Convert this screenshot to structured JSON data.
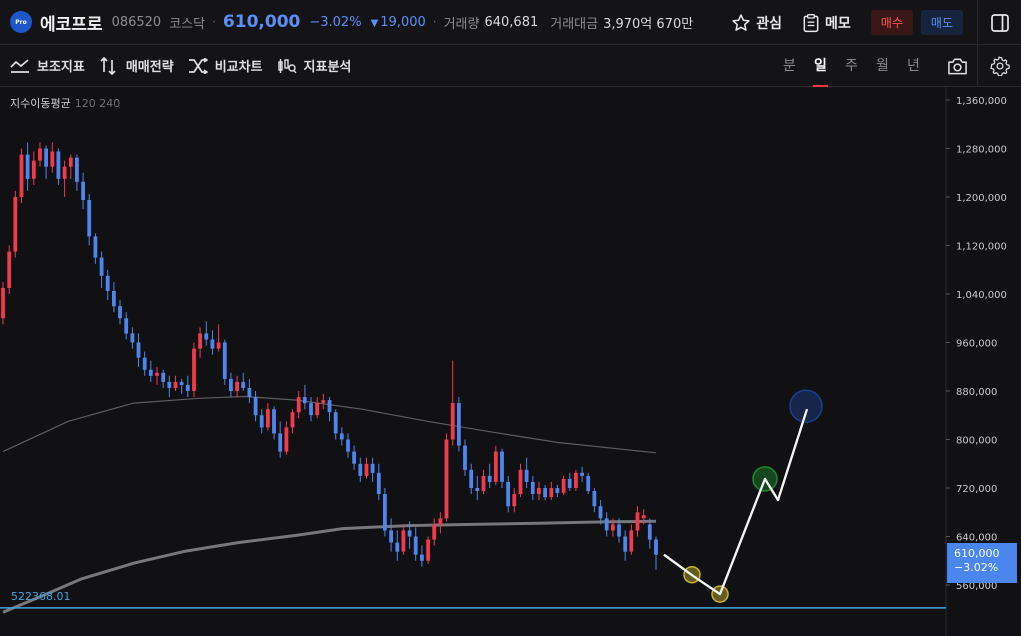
{
  "header": {
    "logo_text": "Pro",
    "stock_name": "에코프로",
    "stock_code": "086520",
    "market": "코스닥",
    "price": "610,000",
    "change_pct": "−3.02%",
    "change_abs": "19,000",
    "volume_label": "거래량",
    "volume_value": "640,681",
    "amount_label": "거래대금",
    "amount_value": "3,970억 670만",
    "watch_label": "관심",
    "memo_label": "메모",
    "buy_label": "매수",
    "sell_label": "매도",
    "colors": {
      "down": "#5b8ff6",
      "up": "#ff5050"
    }
  },
  "toolbar": {
    "tools": [
      "보조지표",
      "매매전략",
      "비교차트",
      "지표분석"
    ],
    "periods": [
      "분",
      "일",
      "주",
      "월",
      "년"
    ],
    "active_period": "일"
  },
  "chart_data": {
    "type": "candlestick",
    "indicator": {
      "name": "지수이동평균",
      "periods": "120 240"
    },
    "y_ticks": [
      "1,360,000",
      "1,280,000",
      "1,200,000",
      "1,120,000",
      "1,040,000",
      "960,000",
      "880,000",
      "800,000",
      "720,000",
      "640,000",
      "560,000"
    ],
    "y_tick_values": [
      1360000,
      1280000,
      1200000,
      1120000,
      1040000,
      960000,
      880000,
      800000,
      720000,
      640000,
      560000
    ],
    "ylim": [
      505000,
      1400000
    ],
    "current_price": {
      "value": 610000,
      "label": "610,000",
      "change": "−3.02%"
    },
    "support_line": {
      "value": 522368.01,
      "label": "522368.01",
      "color": "#3fa5dc"
    },
    "candles": [
      [
        1000000,
        1060000,
        990000,
        1050000
      ],
      [
        1050000,
        1120000,
        1040000,
        1110000
      ],
      [
        1110000,
        1210000,
        1100000,
        1200000
      ],
      [
        1200000,
        1280000,
        1190000,
        1270000
      ],
      [
        1270000,
        1290000,
        1210000,
        1230000
      ],
      [
        1230000,
        1275000,
        1220000,
        1260000
      ],
      [
        1260000,
        1290000,
        1250000,
        1280000
      ],
      [
        1280000,
        1285000,
        1230000,
        1250000
      ],
      [
        1250000,
        1290000,
        1240000,
        1275000
      ],
      [
        1275000,
        1280000,
        1220000,
        1230000
      ],
      [
        1230000,
        1260000,
        1200000,
        1250000
      ],
      [
        1250000,
        1270000,
        1230000,
        1265000
      ],
      [
        1265000,
        1270000,
        1210000,
        1225000
      ],
      [
        1225000,
        1240000,
        1180000,
        1195000
      ],
      [
        1195000,
        1205000,
        1120000,
        1135000
      ],
      [
        1135000,
        1140000,
        1090000,
        1100000
      ],
      [
        1100000,
        1110000,
        1050000,
        1070000
      ],
      [
        1070000,
        1080000,
        1030000,
        1045000
      ],
      [
        1045000,
        1060000,
        1010000,
        1020000
      ],
      [
        1020000,
        1030000,
        990000,
        1000000
      ],
      [
        1000000,
        1010000,
        965000,
        975000
      ],
      [
        975000,
        985000,
        950000,
        960000
      ],
      [
        960000,
        975000,
        920000,
        935000
      ],
      [
        935000,
        945000,
        905000,
        915000
      ],
      [
        915000,
        930000,
        895000,
        905000
      ],
      [
        905000,
        920000,
        890000,
        910000
      ],
      [
        910000,
        915000,
        885000,
        895000
      ],
      [
        895000,
        905000,
        870000,
        885000
      ],
      [
        885000,
        905000,
        880000,
        895000
      ],
      [
        895000,
        900000,
        875000,
        890000
      ],
      [
        890000,
        905000,
        870000,
        880000
      ],
      [
        880000,
        960000,
        870000,
        950000
      ],
      [
        950000,
        985000,
        935000,
        975000
      ],
      [
        975000,
        995000,
        955000,
        965000
      ],
      [
        965000,
        980000,
        940000,
        950000
      ],
      [
        950000,
        990000,
        945000,
        960000
      ],
      [
        960000,
        965000,
        890000,
        900000
      ],
      [
        900000,
        910000,
        870000,
        880000
      ],
      [
        880000,
        905000,
        870000,
        895000
      ],
      [
        895000,
        910000,
        880000,
        885000
      ],
      [
        885000,
        900000,
        860000,
        870000
      ],
      [
        870000,
        880000,
        830000,
        840000
      ],
      [
        840000,
        850000,
        810000,
        820000
      ],
      [
        820000,
        860000,
        815000,
        850000
      ],
      [
        850000,
        855000,
        800000,
        810000
      ],
      [
        810000,
        830000,
        770000,
        780000
      ],
      [
        780000,
        830000,
        775000,
        820000
      ],
      [
        820000,
        850000,
        810000,
        845000
      ],
      [
        845000,
        880000,
        835000,
        870000
      ],
      [
        870000,
        890000,
        850000,
        860000
      ],
      [
        860000,
        870000,
        830000,
        840000
      ],
      [
        840000,
        870000,
        835000,
        860000
      ],
      [
        860000,
        875000,
        850000,
        865000
      ],
      [
        865000,
        870000,
        830000,
        845000
      ],
      [
        845000,
        850000,
        800000,
        810000
      ],
      [
        810000,
        820000,
        790000,
        800000
      ],
      [
        800000,
        810000,
        770000,
        780000
      ],
      [
        780000,
        790000,
        750000,
        760000
      ],
      [
        760000,
        770000,
        730000,
        740000
      ],
      [
        740000,
        770000,
        735000,
        760000
      ],
      [
        760000,
        770000,
        730000,
        745000
      ],
      [
        745000,
        760000,
        700000,
        710000
      ],
      [
        710000,
        720000,
        640000,
        650000
      ],
      [
        650000,
        670000,
        615000,
        630000
      ],
      [
        630000,
        650000,
        600000,
        615000
      ],
      [
        615000,
        660000,
        610000,
        650000
      ],
      [
        650000,
        665000,
        620000,
        640000
      ],
      [
        640000,
        655000,
        600000,
        610000
      ],
      [
        610000,
        625000,
        590000,
        600000
      ],
      [
        600000,
        640000,
        595000,
        635000
      ],
      [
        635000,
        670000,
        625000,
        660000
      ],
      [
        660000,
        680000,
        645000,
        670000
      ],
      [
        670000,
        810000,
        665000,
        800000
      ],
      [
        800000,
        930000,
        790000,
        860000
      ],
      [
        860000,
        870000,
        780000,
        790000
      ],
      [
        790000,
        800000,
        740000,
        750000
      ],
      [
        750000,
        760000,
        710000,
        720000
      ],
      [
        720000,
        740000,
        700000,
        715000
      ],
      [
        715000,
        750000,
        710000,
        740000
      ],
      [
        740000,
        760000,
        720000,
        730000
      ],
      [
        730000,
        790000,
        725000,
        780000
      ],
      [
        780000,
        785000,
        720000,
        730000
      ],
      [
        730000,
        740000,
        680000,
        690000
      ],
      [
        690000,
        720000,
        680000,
        710000
      ],
      [
        710000,
        760000,
        705000,
        750000
      ],
      [
        750000,
        770000,
        720000,
        730000
      ],
      [
        730000,
        740000,
        700000,
        710000
      ],
      [
        710000,
        730000,
        700000,
        720000
      ],
      [
        720000,
        725000,
        700000,
        705000
      ],
      [
        705000,
        730000,
        700000,
        720000
      ],
      [
        720000,
        725000,
        705000,
        712000
      ],
      [
        712000,
        740000,
        708000,
        735000
      ],
      [
        735000,
        745000,
        715000,
        720000
      ],
      [
        720000,
        750000,
        715000,
        745000
      ],
      [
        745000,
        755000,
        730000,
        740000
      ],
      [
        740000,
        745000,
        710000,
        715000
      ],
      [
        715000,
        720000,
        680000,
        690000
      ],
      [
        690000,
        700000,
        660000,
        670000
      ],
      [
        670000,
        680000,
        640000,
        650000
      ],
      [
        650000,
        670000,
        640000,
        660000
      ],
      [
        660000,
        670000,
        630000,
        640000
      ],
      [
        640000,
        650000,
        600000,
        615000
      ],
      [
        615000,
        660000,
        610000,
        650000
      ],
      [
        650000,
        690000,
        640000,
        680000
      ],
      [
        670000,
        685000,
        660000,
        675000
      ],
      [
        660000,
        670000,
        620000,
        635000
      ],
      [
        635000,
        640000,
        585000,
        610000
      ]
    ],
    "ema120": [
      [
        0,
        780000
      ],
      [
        0.1,
        830000
      ],
      [
        0.2,
        860000
      ],
      [
        0.3,
        868000
      ],
      [
        0.37,
        871000
      ],
      [
        0.45,
        865000
      ],
      [
        0.55,
        850000
      ],
      [
        0.65,
        830000
      ],
      [
        0.75,
        812000
      ],
      [
        0.85,
        795000
      ],
      [
        1.0,
        778000
      ]
    ],
    "ema240": [
      [
        0,
        515000
      ],
      [
        0.06,
        542000
      ],
      [
        0.12,
        570000
      ],
      [
        0.2,
        596000
      ],
      [
        0.28,
        616000
      ],
      [
        0.36,
        630000
      ],
      [
        0.45,
        642000
      ],
      [
        0.52,
        653000
      ],
      [
        0.62,
        658000
      ],
      [
        0.72,
        660000
      ],
      [
        0.82,
        662000
      ],
      [
        0.92,
        664000
      ],
      [
        1.0,
        665000
      ]
    ],
    "projection": [
      [
        610000
      ],
      [
        575000
      ],
      [
        545000
      ],
      [
        735000
      ],
      [
        700000
      ],
      [
        850000
      ]
    ],
    "markers": [
      {
        "value": 577000,
        "color": "#c9b52d",
        "size": "small"
      },
      {
        "value": 545000,
        "color": "#c9b52d",
        "size": "small"
      },
      {
        "value": 735000,
        "color": "#1f8a2e",
        "size": "medium"
      },
      {
        "value": 855000,
        "color": "#1d3f8a",
        "size": "large"
      }
    ]
  }
}
